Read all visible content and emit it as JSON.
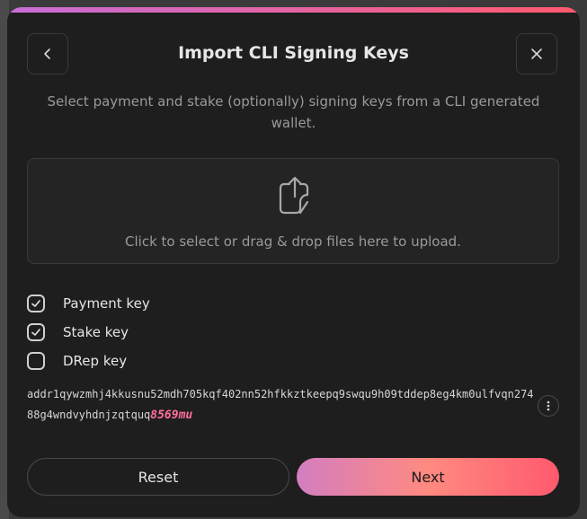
{
  "header": {
    "title": "Import CLI Signing Keys",
    "subtitle": "Select payment and stake (optionally) signing keys from a CLI generated wallet."
  },
  "dropzone": {
    "text": "Click to select or drag & drop files here to upload."
  },
  "keys": [
    {
      "label": "Payment key",
      "checked": true
    },
    {
      "label": "Stake key",
      "checked": true
    },
    {
      "label": "DRep key",
      "checked": false
    }
  ],
  "address": {
    "line1": "addr1qywzmhj4kkusnu52mdh705kqf402nn52hfkkztkeepq9swqu9h09tddep8eg4km0ulf",
    "line2": "vqn27488g4wndvyhdnjzqtquq",
    "highlight": "8569mu"
  },
  "buttons": {
    "reset": "Reset",
    "next": "Next"
  },
  "colors": {
    "accent_start": "#c86dd7",
    "accent_end": "#ff5a6e",
    "highlight": "#ff6f9b"
  },
  "icons": {
    "back": "chevron-left-icon",
    "close": "close-icon",
    "upload": "upload-file-icon",
    "check": "check-icon",
    "more": "more-vertical-icon"
  }
}
